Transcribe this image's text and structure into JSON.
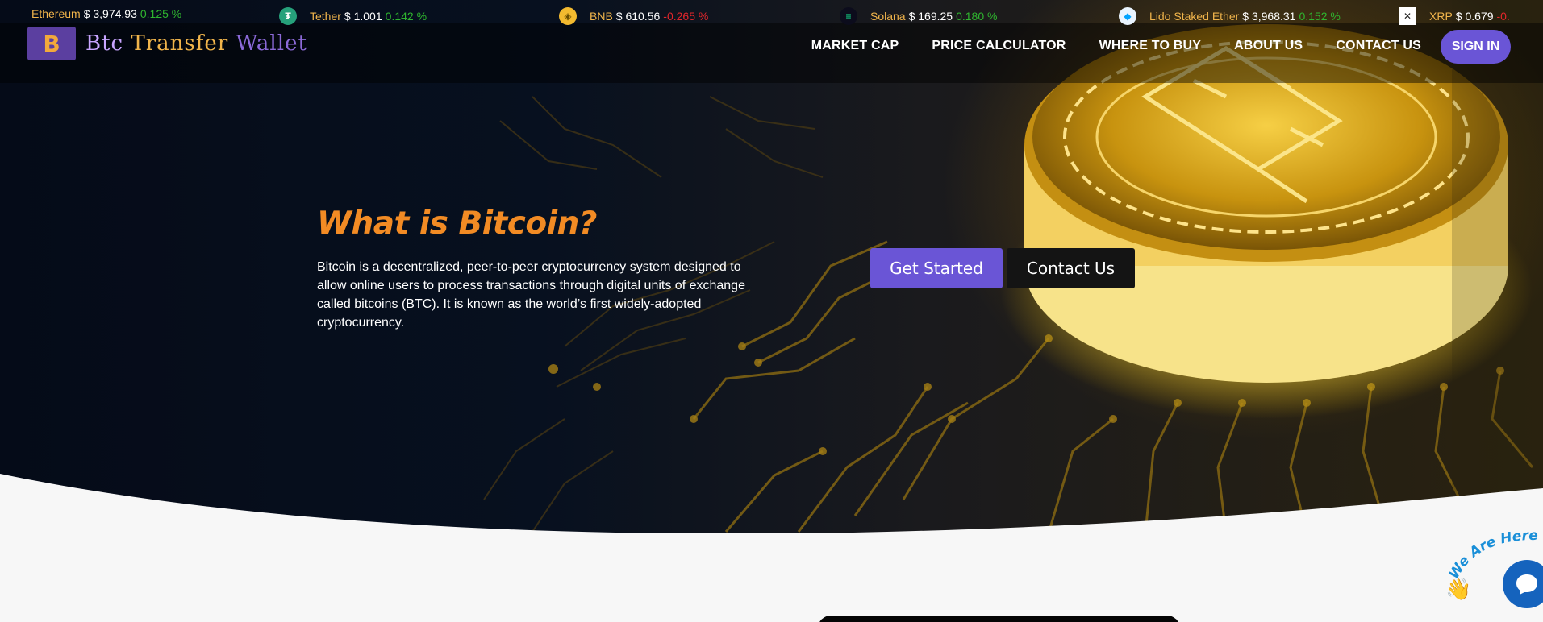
{
  "ticker": [
    {
      "name": "Ethereum",
      "price": "$ 3,974.93",
      "change": "0.125 %",
      "dir": "up",
      "icon": "ethereum-icon",
      "color": "#627eea"
    },
    {
      "name": "Tether",
      "price": "$ 1.001",
      "change": "0.142 %",
      "dir": "up",
      "icon": "tether-icon",
      "color": "#26a17b"
    },
    {
      "name": "BNB",
      "price": "$ 610.56",
      "change": "-0.265 %",
      "dir": "down",
      "icon": "bnb-icon",
      "color": "#f3ba2f"
    },
    {
      "name": "Solana",
      "price": "$ 169.25",
      "change": "0.180 %",
      "dir": "up",
      "icon": "solana-icon",
      "color": "#14f195"
    },
    {
      "name": "Lido Staked Ether",
      "price": "$ 3,968.31",
      "change": "0.152 %",
      "dir": "up",
      "icon": "lido-icon",
      "color": "#00a3ff"
    },
    {
      "name": "XRP",
      "price": "$ 0.679",
      "change": "-0.",
      "dir": "down",
      "icon": "xrp-icon",
      "color": "#ffffff"
    }
  ],
  "brand": {
    "logo_glyph": "B",
    "part1": "Btc",
    "part2": "Transfer",
    "part3": "Wallet"
  },
  "nav": {
    "items": [
      "MARKET CAP",
      "PRICE CALCULATOR",
      "WHERE TO BUY",
      "ABOUT US",
      "CONTACT US"
    ],
    "signin": "SIGN IN"
  },
  "hero": {
    "title": "What is Bitcoin?",
    "description": "Bitcoin is a decentralized, peer-to-peer cryptocurrency system designed to allow online users to process transactions through digital units of exchange called bitcoins (BTC). It is known as the world’s first widely-adopted cryptocurrency.",
    "primary_cta": "Get Started",
    "secondary_cta": "Contact Us"
  },
  "chat": {
    "badge": "We Are Here!",
    "wave_emoji": "👋"
  },
  "colors": {
    "accent": "#6a55d6",
    "headline": "#f28b24",
    "brand_gold": "#f0b44b",
    "up": "#2fb52f",
    "down": "#e2262b"
  }
}
